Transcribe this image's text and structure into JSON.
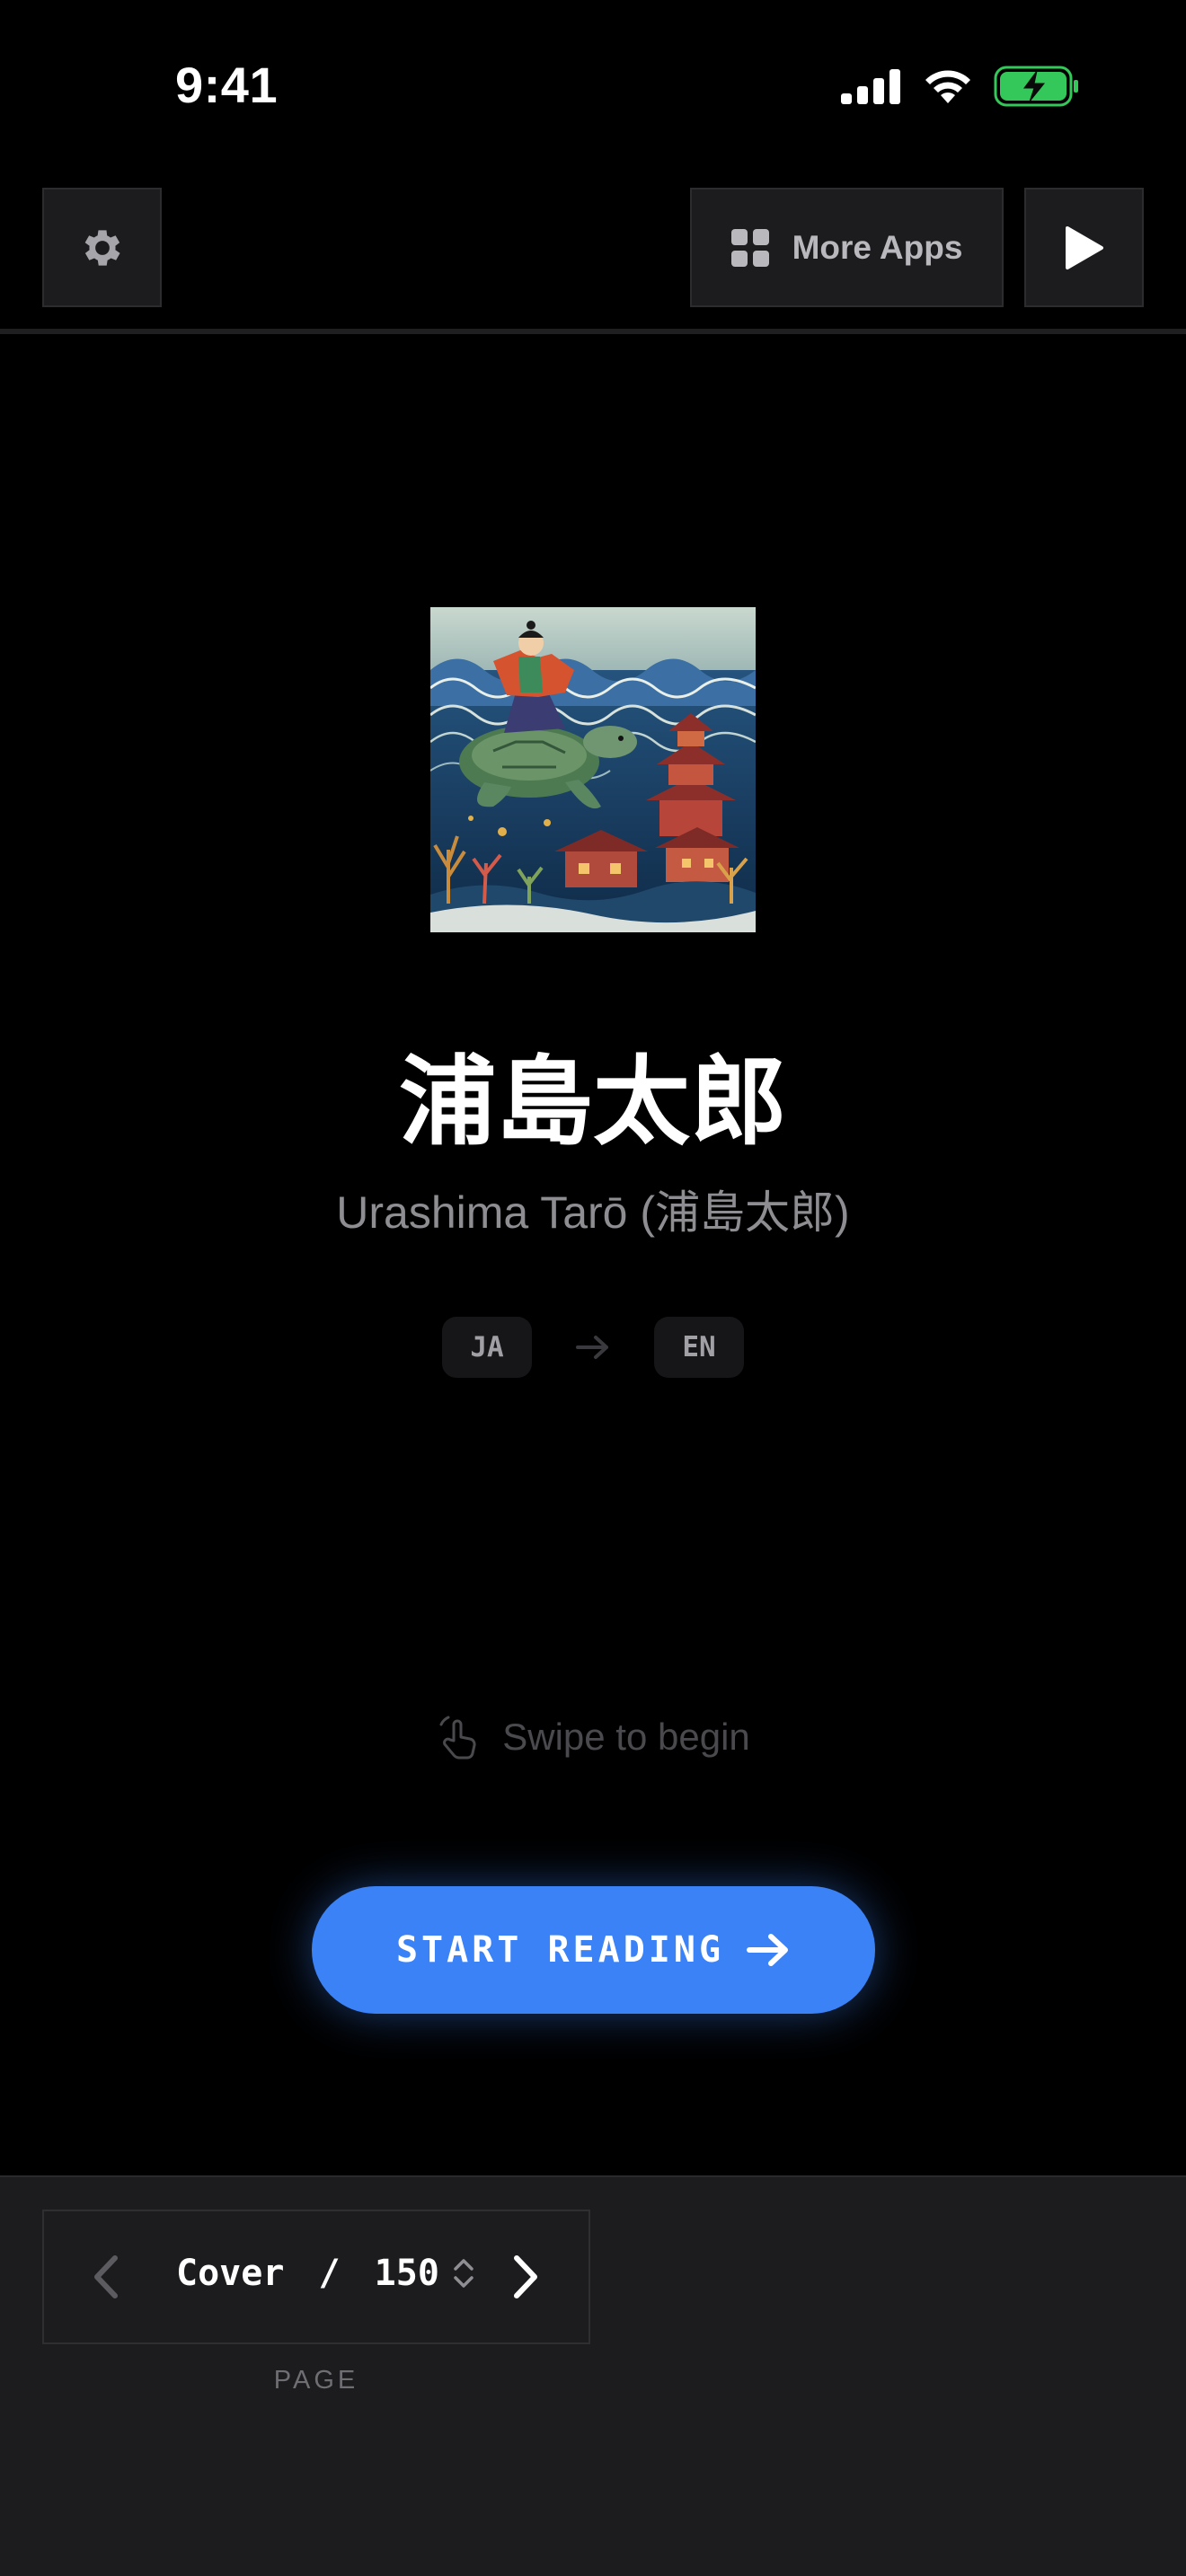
{
  "status_bar": {
    "time": "9:41",
    "icons": [
      "cellular-signal-icon",
      "wifi-icon",
      "battery-charging-icon"
    ],
    "battery_color": "#34c759"
  },
  "toolbar": {
    "settings_icon": "gear-icon",
    "more_apps_label": "More Apps",
    "more_apps_icon": "grid-icon",
    "play_icon": "play-icon"
  },
  "cover": {
    "title": "浦島太郎",
    "subtitle": "Urashima Tarō (浦島太郎)",
    "source_lang": "JA",
    "target_lang": "EN",
    "swipe_hint": "Swipe to begin",
    "start_label": "START READING",
    "accent_color": "#3b82f6"
  },
  "pager": {
    "current": "Cover",
    "separator": " / ",
    "total": "150",
    "caption": "PAGE"
  }
}
